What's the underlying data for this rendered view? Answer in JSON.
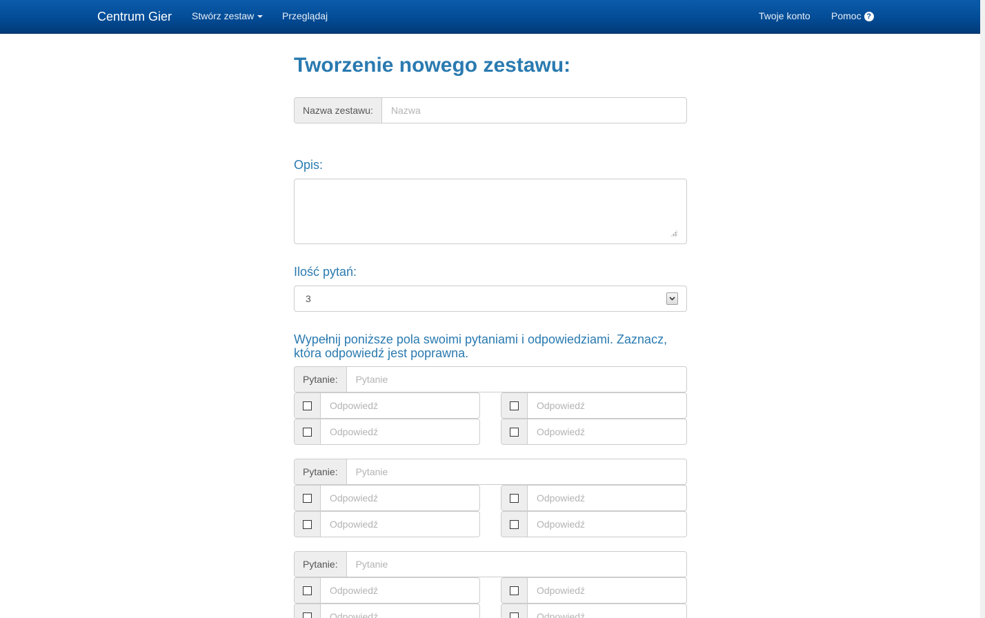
{
  "navbar": {
    "brand": "Centrum Gier",
    "create_menu": "Stwórz zestaw",
    "browse": "Przeglądaj",
    "account": "Twoje konto",
    "help": "Pomoc",
    "help_icon": "question-circle-icon"
  },
  "form": {
    "title": "Tworzenie nowego zestawu:",
    "name": {
      "label": "Nazwa zestawu:",
      "placeholder": "Nazwa",
      "value": ""
    },
    "description": {
      "label": "Opis:",
      "value": ""
    },
    "question_count": {
      "label": "Ilość pytań:",
      "value": "3"
    },
    "instructions": "Wypełnij poniższe pola swoimi pytaniami i odpowiedziami. Zaznacz, która odpowiedź jest poprawna.",
    "questions": [
      {
        "label": "Pytanie:",
        "placeholder": "Pytanie",
        "answers": [
          {
            "placeholder": "Odpowiedź",
            "checked": false
          },
          {
            "placeholder": "Odpowiedź",
            "checked": false
          },
          {
            "placeholder": "Odpowiedź",
            "checked": false
          },
          {
            "placeholder": "Odpowiedź",
            "checked": false
          }
        ]
      },
      {
        "label": "Pytanie:",
        "placeholder": "Pytanie",
        "answers": [
          {
            "placeholder": "Odpowiedź",
            "checked": false
          },
          {
            "placeholder": "Odpowiedź",
            "checked": false
          },
          {
            "placeholder": "Odpowiedź",
            "checked": false
          },
          {
            "placeholder": "Odpowiedź",
            "checked": false
          }
        ]
      },
      {
        "label": "Pytanie:",
        "placeholder": "Pytanie",
        "answers": [
          {
            "placeholder": "Odpowiedź",
            "checked": false
          },
          {
            "placeholder": "Odpowiedź",
            "checked": false
          },
          {
            "placeholder": "Odpowiedź",
            "checked": false
          },
          {
            "placeholder": "Odpowiedź",
            "checked": false
          }
        ]
      }
    ]
  },
  "colors": {
    "navbar": "#034c96",
    "heading": "#2a7ab0",
    "addon_bg": "#eeeeee",
    "border": "#cccccc"
  }
}
